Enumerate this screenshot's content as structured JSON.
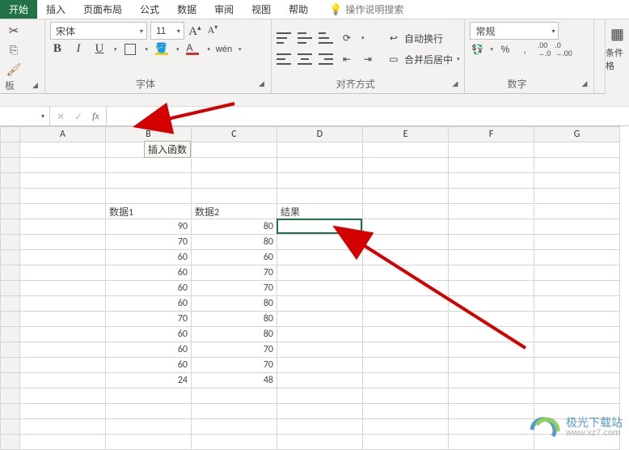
{
  "tabs": {
    "start": "开始",
    "insert": "插入",
    "layout": "页面布局",
    "formulas": "公式",
    "data": "数据",
    "review": "审阅",
    "view": "视图",
    "help": "帮助",
    "tellme": "操作说明搜索"
  },
  "ribbon": {
    "clipboard_label": "板",
    "font_name": "宋体",
    "font_size": "11",
    "font_label": "字体",
    "align_label": "对齐方式",
    "wraptext": "自动换行",
    "mergecenter": "合并后居中",
    "number_format": "常规",
    "number_label": "数字",
    "cond_fmt": "条件格"
  },
  "formula_bar": {
    "tooltip": "插入函数",
    "namebox_caret": "▾",
    "cancel": "✕",
    "enter": "✓",
    "fx": "fx"
  },
  "columns": [
    "A",
    "B",
    "C",
    "D",
    "E",
    "F",
    "G"
  ],
  "headers": {
    "b": "数据1",
    "c": "数据2",
    "d": "结果"
  },
  "rows": [
    {
      "b": 90,
      "c": 80
    },
    {
      "b": 70,
      "c": 80
    },
    {
      "b": 60,
      "c": 60
    },
    {
      "b": 60,
      "c": 70
    },
    {
      "b": 60,
      "c": 70
    },
    {
      "b": 60,
      "c": 80
    },
    {
      "b": 70,
      "c": 80
    },
    {
      "b": 60,
      "c": 80
    },
    {
      "b": 60,
      "c": 70
    },
    {
      "b": 60,
      "c": 70
    },
    {
      "b": 24,
      "c": 48
    }
  ],
  "watermark": {
    "title": "极光下载站",
    "url": "www.xz7.com"
  },
  "icons": {
    "cut": "✂",
    "copy": "⎘",
    "painter": "🖌",
    "incfont": "A",
    "decfont": "A",
    "phonetic": "wén",
    "bold": "B",
    "italic": "I",
    "underline": "U",
    "fillcolor": "A",
    "fontcolor": "A",
    "percent": "%",
    "comma": ",",
    "inc_dec": "←0 .00",
    "dec_dec": ".00 →0",
    "currency": "¥"
  }
}
